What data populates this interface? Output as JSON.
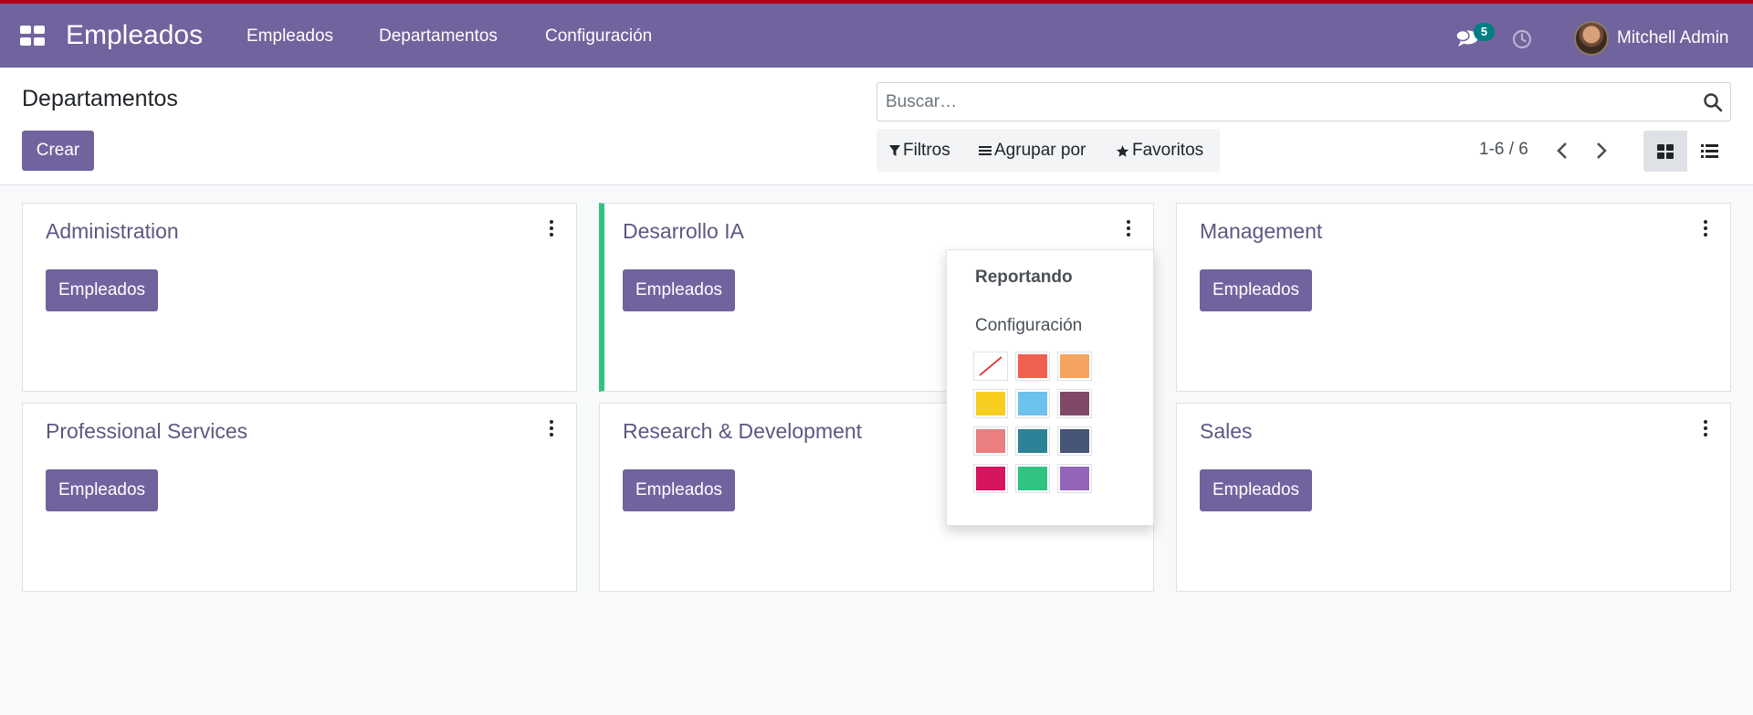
{
  "navbar": {
    "app_name": "Empleados",
    "menu": [
      "Empleados",
      "Departamentos",
      "Configuración"
    ],
    "chat_count": "5",
    "user_name": "Mitchell Admin",
    "background": "#71639e"
  },
  "control_panel": {
    "title": "Departamentos",
    "create_label": "Crear",
    "search_placeholder": "Buscar…",
    "filters_label": "Filtros",
    "group_by_label": "Agrupar por",
    "favorites_label": "Favoritos",
    "pager": "1-6 / 6"
  },
  "cards": [
    {
      "name": "Administration",
      "button": "Empleados"
    },
    {
      "name": "Desarrollo IA",
      "button": "Empleados",
      "accent_color": "#30c381"
    },
    {
      "name": "Management",
      "button": "Empleados"
    },
    {
      "name": "Professional Services",
      "button": "Empleados"
    },
    {
      "name": "Research & Development",
      "button": "Empleados"
    },
    {
      "name": "Sales",
      "button": "Empleados"
    }
  ],
  "dropdown": {
    "reporting_label": "Reportando",
    "config_label": "Configuración",
    "colors": [
      "none",
      "#f06050",
      "#f4a460",
      "#f7cd1f",
      "#6cc1ed",
      "#814968",
      "#eb7e7f",
      "#2c8397",
      "#475577",
      "#d6145f",
      "#30c381",
      "#9365b8"
    ]
  }
}
